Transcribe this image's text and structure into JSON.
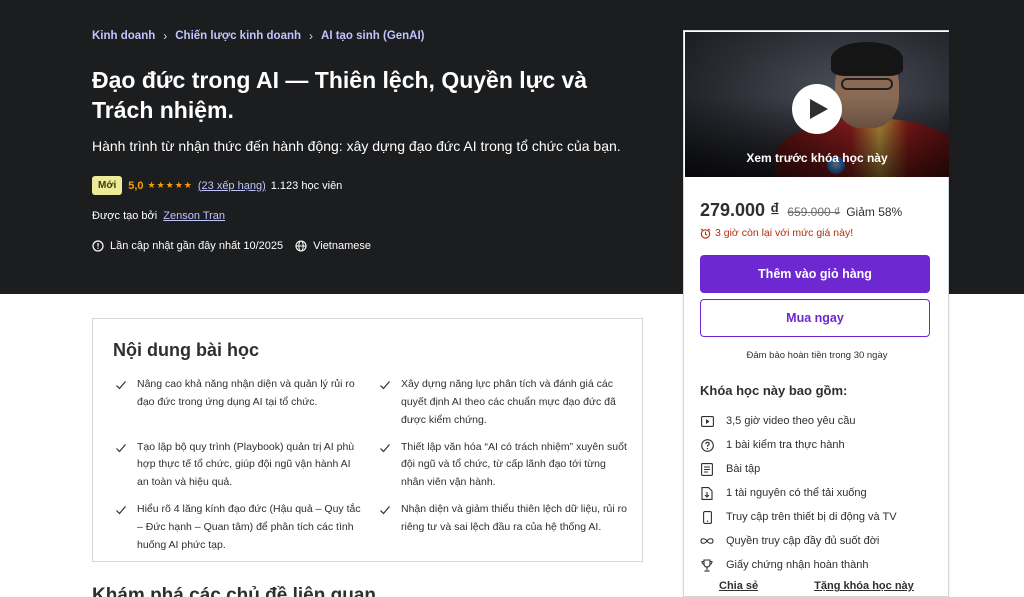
{
  "breadcrumb": [
    {
      "label": "Kinh doanh"
    },
    {
      "label": "Chiến lược kinh doanh"
    },
    {
      "label": "AI tạo sinh (GenAI)"
    }
  ],
  "course": {
    "title": "Đạo đức trong AI — Thiên lệch, Quyền lực và Trách nhiệm.",
    "subtitle": "Hành trình từ nhận thức đến hành động: xây dựng đạo đức AI trong tổ chức của bạn.",
    "badge": "Mới",
    "rating": "5,0",
    "stars": "★★★★★",
    "rating_count": "(23 xếp hạng)",
    "students": "1.123 học viên",
    "created_by_label": "Được tạo bởi",
    "author": "Zenson Tran",
    "last_updated": "Lần cập nhật gần đây nhất 10/2025",
    "language": "Vietnamese"
  },
  "sidebar": {
    "preview_label": "Xem trước khóa học này",
    "price_current": "279.000 ₫",
    "price_original": "659.000 ₫",
    "discount": "Giảm 58%",
    "timer": "3 giờ còn lại với mức giá này!",
    "add_to_cart": "Thêm vào giỏ hàng",
    "buy_now": "Mua ngay",
    "guarantee": "Đảm bảo hoàn tiền trong 30 ngày",
    "includes_title": "Khóa học này bao gồm:",
    "includes": [
      {
        "icon": "video-icon",
        "label": "3,5 giờ video theo yêu cầu"
      },
      {
        "icon": "quiz-icon",
        "label": "1 bài kiểm tra thực hành"
      },
      {
        "icon": "assignment-icon",
        "label": "Bài tập"
      },
      {
        "icon": "download-icon",
        "label": "1 tài nguyên có thể tải xuống"
      },
      {
        "icon": "mobile-icon",
        "label": "Truy cập trên thiết bị di động và TV"
      },
      {
        "icon": "infinity-icon",
        "label": "Quyền truy cập đầy đủ suốt đời"
      },
      {
        "icon": "trophy-icon",
        "label": "Giấy chứng nhận hoàn thành"
      }
    ],
    "share": "Chia sẻ",
    "gift": "Tặng khóa học này"
  },
  "learn": {
    "title": "Nội dung bài học",
    "items": [
      "Nâng cao khả năng nhận diện và quản lý rủi ro đạo đức trong ứng dụng AI tại tổ chức.",
      "Xây dựng năng lực phân tích và đánh giá các quyết định AI theo các chuẩn mực đạo đức đã được kiểm chứng.",
      "Tạo lập bộ quy trình (Playbook) quản trị AI phù hợp thực tế tổ chức, giúp đội ngũ vận hành AI an toàn và hiệu quả.",
      "Thiết lập văn hóa “AI có trách nhiệm” xuyên suốt đội ngũ và tổ chức, từ cấp lãnh đạo tới từng nhân viên vận hành.",
      "Hiểu rõ 4 lăng kính đạo đức (Hậu quả – Quy tắc – Đức hạnh – Quan tâm) để phân tích các tình huống AI phức tạp.",
      "Nhận diện và giảm thiểu thiên lệch dữ liệu, rủi ro riêng tư và sai lệch đầu ra của hệ thống AI."
    ]
  },
  "explore_title": "Khám phá các chủ đề liên quan",
  "colors": {
    "hero_bg": "#1c1d1f",
    "accent": "#6d28d2",
    "link": "#c0c4fc",
    "star": "#f69c08",
    "urgent": "#b32d0f"
  }
}
